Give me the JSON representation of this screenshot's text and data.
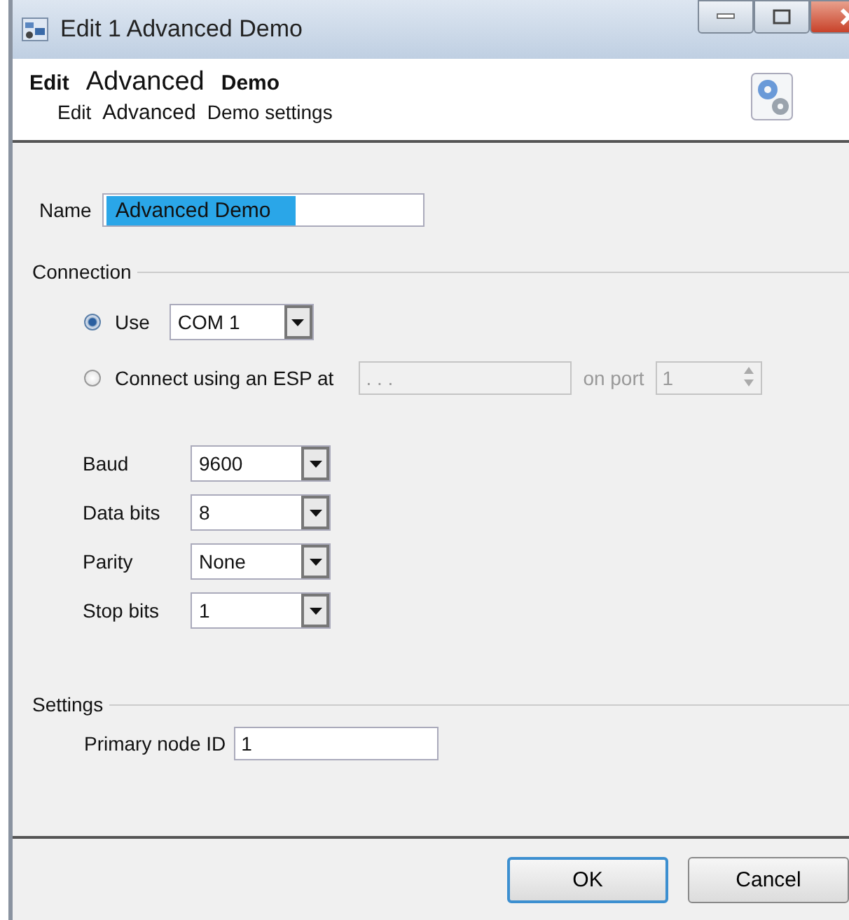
{
  "window": {
    "title": "Edit 1 Advanced Demo"
  },
  "header": {
    "title_parts": [
      {
        "kind": "bold",
        "text": "Edit"
      },
      {
        "kind": "large",
        "text": "Advanced"
      },
      {
        "kind": "bold",
        "text": "Demo"
      }
    ],
    "subtitle_parts": [
      {
        "kind": "plain",
        "text": "Edit"
      },
      {
        "kind": "large",
        "text": "Advanced"
      },
      {
        "kind": "plain",
        "text": "Demo settings"
      }
    ]
  },
  "name": {
    "label": "Name",
    "value": "Advanced Demo",
    "highlighted": true
  },
  "connection": {
    "title": "Connection",
    "options": [
      {
        "kind": "combo",
        "label": "Use",
        "selected": true,
        "value": "COM 1"
      },
      {
        "kind": "address",
        "label": "Connect using an ESP at",
        "selected": false,
        "address": ". . .",
        "disabled": true,
        "port_label": "on port",
        "port": "1"
      }
    ]
  },
  "serial": [
    {
      "label": "Baud",
      "value": "9600"
    },
    {
      "label": "Data bits",
      "value": "8"
    },
    {
      "label": "Parity",
      "value": "None"
    },
    {
      "label": "Stop bits",
      "value": "1"
    }
  ],
  "settings": {
    "title": "Settings",
    "fields": [
      {
        "label": "Primary node ID",
        "value": "1"
      }
    ]
  },
  "buttons": [
    {
      "label": "OK",
      "default": true
    },
    {
      "label": "Cancel",
      "default": false
    }
  ]
}
